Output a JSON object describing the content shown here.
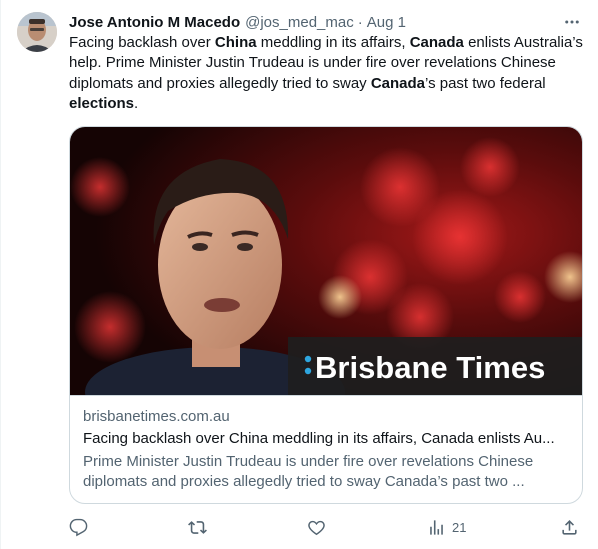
{
  "tweet": {
    "author_name": "Jose Antonio M Macedo",
    "handle": "@jos_med_mac",
    "separator": "·",
    "date": "Aug 1",
    "text_segments": [
      {
        "t": "Facing backlash over ",
        "b": false
      },
      {
        "t": "China",
        "b": true
      },
      {
        "t": " meddling in its affairs, ",
        "b": false
      },
      {
        "t": "Canada",
        "b": true
      },
      {
        "t": " enlists Australia’s help. Prime Minister Justin Trudeau is under fire over revelations Chinese diplomats and proxies allegedly tried to sway ",
        "b": false
      },
      {
        "t": "Canada",
        "b": true
      },
      {
        "t": "’s past two federal ",
        "b": false
      },
      {
        "t": "elections",
        "b": true
      },
      {
        "t": ".",
        "b": false
      }
    ]
  },
  "card": {
    "image_brand": "Brisbane Times",
    "domain": "brisbanetimes.com.au",
    "title": "Facing backlash over China meddling in its affairs, Canada enlists Au...",
    "description": "Prime Minister Justin Trudeau is under fire over revelations Chinese diplomats and proxies allegedly tried to sway Canada’s past two ..."
  },
  "actions": {
    "reply_icon": "reply-icon",
    "retweet_icon": "retweet-icon",
    "like_icon": "like-icon",
    "views_icon": "views-icon",
    "views_count": "21",
    "share_icon": "share-icon"
  },
  "colors": {
    "text": "#0f1419",
    "secondary": "#536471",
    "border": "#cfd9de"
  }
}
